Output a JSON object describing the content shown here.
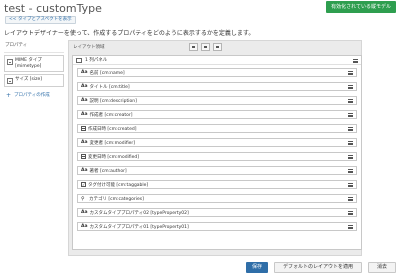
{
  "header": {
    "title": "test - customType",
    "model_badge": "有効化されている縦モデル",
    "back_button": "<< タイプとアスペクトを表示",
    "description": "レイアウトデザイナーを使って、作成するプロパティをどのように表示するかを定義します。"
  },
  "properties_panel": {
    "heading": "プロパティ",
    "items": [
      {
        "icon": "text-field-icon",
        "label": "MIME タイプ\n[mimetype]"
      },
      {
        "icon": "text-field-icon",
        "label": "サイズ [size]"
      }
    ],
    "create_label": "プロパティの作成"
  },
  "layout": {
    "heading": "レイアウト領域",
    "layout_buttons": [
      "single-column",
      "two-column",
      "three-column"
    ],
    "panel_label": "1 列パネル",
    "fields": [
      {
        "icon": "Aa",
        "label": "名前 [cm:name]"
      },
      {
        "icon": "Aa",
        "label": "タイトル [cm:title]"
      },
      {
        "icon": "Aa",
        "label": "説明 [cm:description]"
      },
      {
        "icon": "Aa",
        "label": "作成者 [cm:creator]"
      },
      {
        "icon": "calendar",
        "label": "作成日時 [cm:created]"
      },
      {
        "icon": "Aa",
        "label": "変更者 [cm:modifier]"
      },
      {
        "icon": "calendar",
        "label": "変更日時 [cm:modified]"
      },
      {
        "icon": "Aa",
        "label": "著者 [cm:author]"
      },
      {
        "icon": "checkbox",
        "label": "タグ付け可能 [cm:taggable]"
      },
      {
        "icon": "category",
        "label": "カテゴリ [cm:categories]"
      },
      {
        "icon": "Aa",
        "label": "カスタムタイププロパティ02 [typeProperty02]"
      },
      {
        "icon": "Aa",
        "label": "カスタムタイププロパティ01 [typeProperty01]"
      }
    ]
  },
  "footer": {
    "save": "保存",
    "apply_default": "デフォルトのレイアウトを適用",
    "clear": "消去"
  },
  "colors": {
    "accent_blue": "#2f6ea8",
    "badge_green": "#2e9e4f",
    "canvas_bg": "#ebebeb"
  }
}
